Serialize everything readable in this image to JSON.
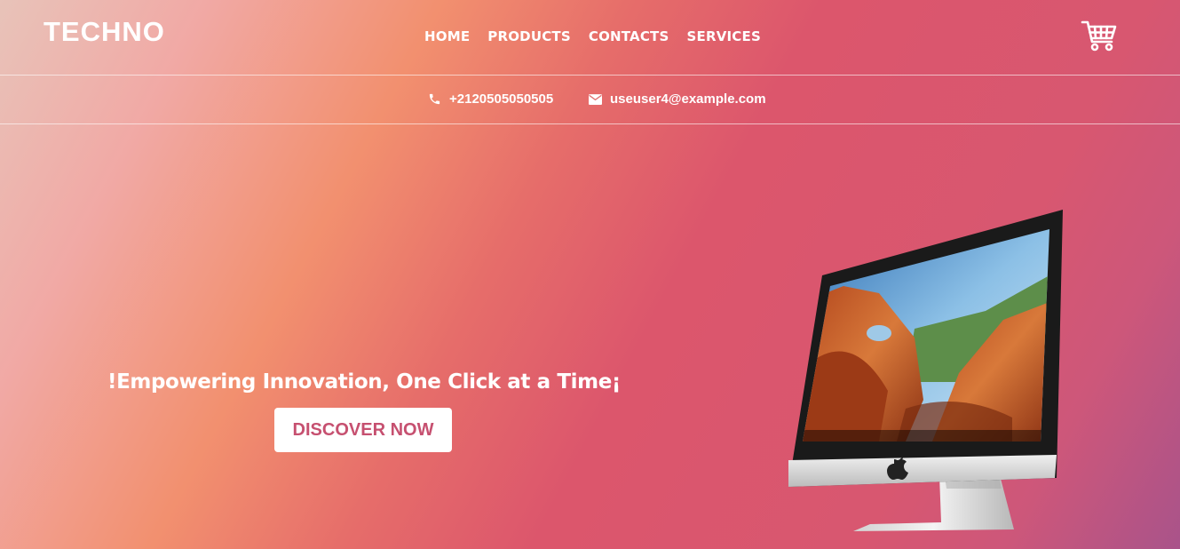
{
  "brand": {
    "logo": "TECHNO"
  },
  "nav": {
    "items": [
      {
        "label": "HOME"
      },
      {
        "label": "PRODUCTS"
      },
      {
        "label": "CONTACTS"
      },
      {
        "label": "SERVICES"
      }
    ],
    "cart_icon": "shopping-cart-icon"
  },
  "contact": {
    "phone": "+2120505050505",
    "email": "useuser4@example.com",
    "phone_icon": "phone-icon",
    "email_icon": "envelope-icon"
  },
  "hero": {
    "title": "!Empowering Innovation, One Click at a Time¡",
    "cta_label": "DISCOVER NOW",
    "image": "imac-computer"
  },
  "colors": {
    "cta_text": "#c65070",
    "gradient": [
      "#e8c3b9",
      "#f1a9a5",
      "#f2906f",
      "#dc566c",
      "#a9538a"
    ]
  }
}
